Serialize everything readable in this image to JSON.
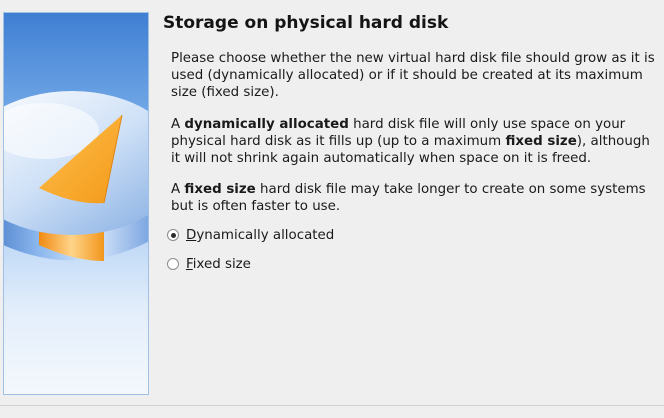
{
  "wizard": {
    "title": "Storage on physical hard disk",
    "paragraph1": "Please choose whether the new virtual hard disk file should grow as it is used (dynamically allocated) or if it should be created at its maximum size (fixed size).",
    "paragraph2": {
      "a": "A ",
      "b": "dynamically allocated",
      "c": " hard disk file will only use space on your physical hard disk as it fills up (up to a maximum ",
      "d": "fixed size",
      "e": "), although it will not shrink again automatically when space on it is freed."
    },
    "paragraph3": {
      "a": "A ",
      "b": "fixed size",
      "c": " hard disk file may take longer to create on some systems but is often faster to use."
    },
    "options": [
      {
        "first": "D",
        "rest": "ynamically allocated",
        "selected": true
      },
      {
        "first": "F",
        "rest": "ixed size",
        "selected": false
      }
    ]
  },
  "colors": {
    "panel_background": "#efefef",
    "image_border": "#9fc0e2",
    "disk_blue": "#3f7fd2",
    "disk_orange": "#f5a623"
  },
  "icons": {
    "side_image": "hard-disk-illustration-icon",
    "radio_selected": "radio-checked",
    "radio_unselected": "radio-unchecked"
  }
}
